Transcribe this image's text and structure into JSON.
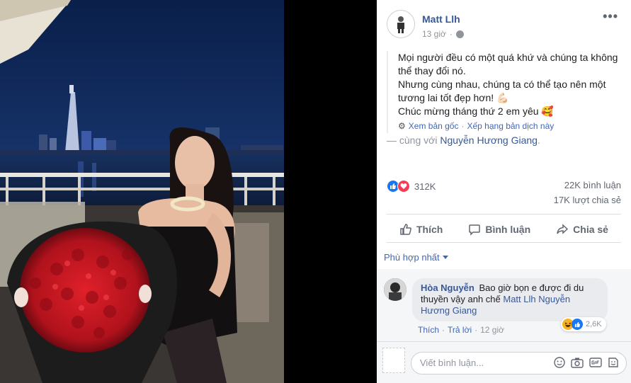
{
  "post": {
    "author": "Matt Llh",
    "time": "13 giờ",
    "lines": [
      "Mọi người đều có một quá khứ và chúng ta không thể thay đổi nó.",
      "Nhưng cùng nhau, chúng ta có thể tạo nên một tương lai tốt đẹp hơn! 💪🏻",
      "Chúc mừng tháng thứ 2 em yêu 🥰"
    ],
    "see_original": "Xem bản gốc",
    "rate_translation": "Xếp hạng bản dịch này",
    "with_prefix": "— cùng với",
    "with_name": "Nguyễn Hương Giang"
  },
  "stats": {
    "reactions": "312K",
    "comments": "22K bình luận",
    "shares": "17K lượt chia sẻ"
  },
  "actions": {
    "like": "Thích",
    "comment": "Bình luận",
    "share": "Chia sẻ"
  },
  "comments": {
    "filter": "Phù hợp nhất",
    "first": {
      "name": "Hòa Nguyễn",
      "text": "Bao giờ bọn e được đi du thuyền vậy anh chế",
      "tag1": "Matt Llh",
      "tag2": "Nguyễn Hương Giang",
      "like": "Thích",
      "reply": "Trả lời",
      "time": "12 giờ",
      "reactions": "2,6K"
    },
    "composer_placeholder": "Viết bình luận..."
  },
  "colors": {
    "link": "#365899",
    "like_blue": "#1877f2",
    "love_red": "#f33e58"
  }
}
